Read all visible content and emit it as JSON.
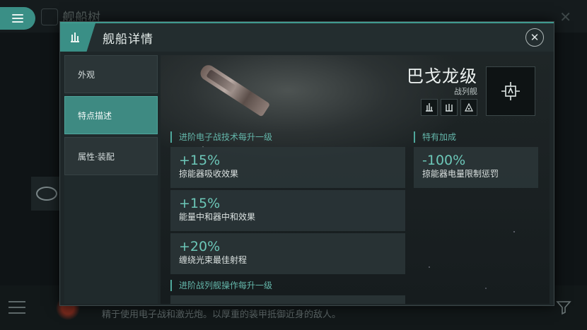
{
  "background": {
    "title": "舰船树",
    "description": "精于使用电子战和激光炮。以厚重的装甲抵御近身的敌人。"
  },
  "modal": {
    "title": "舰船详情",
    "close_label": "✕"
  },
  "nav": [
    {
      "label": "外观"
    },
    {
      "label": "特点描述"
    },
    {
      "label": "属性·装配"
    }
  ],
  "ship": {
    "name": "巴戈龙级",
    "class": "战列舰"
  },
  "sections": {
    "left_header": "进阶电子战技术每升一级",
    "right_header": "特有加成",
    "second_left_header": "进阶战列舰操作每升一级"
  },
  "bonuses_left": [
    {
      "value": "+15%",
      "desc": "掠能器吸收效果"
    },
    {
      "value": "+15%",
      "desc": "能量中和器中和效果"
    },
    {
      "value": "+20%",
      "desc": "缠绕光束最佳射程"
    }
  ],
  "bonuses_right": [
    {
      "value": "-100%",
      "desc": "掠能器电量限制惩罚"
    }
  ],
  "icons": [
    "menu-icon",
    "ship-tree-icon",
    "close-icon",
    "ship-detail-icon",
    "role-icon",
    "filter-icon"
  ],
  "colors": {
    "accent": "#3e8a82",
    "bonus_value": "#6cc7b8",
    "section_header": "#64b6aa"
  }
}
